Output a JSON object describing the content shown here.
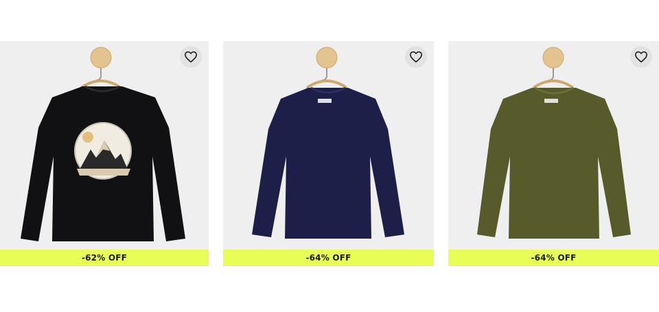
{
  "products": [
    {
      "discount_label": "-62% OFF",
      "color": "#111114",
      "icon": "heart-outline-icon"
    },
    {
      "discount_label": "-64% OFF",
      "color": "#1d1f48",
      "icon": "heart-outline-icon"
    },
    {
      "discount_label": "-64% OFF",
      "color": "#575a2b",
      "icon": "heart-outline-icon"
    }
  ],
  "colors": {
    "card_background": "#efeff0",
    "discount_background": "#e8fd55",
    "favorite_button_background": "#e2e2e3"
  }
}
